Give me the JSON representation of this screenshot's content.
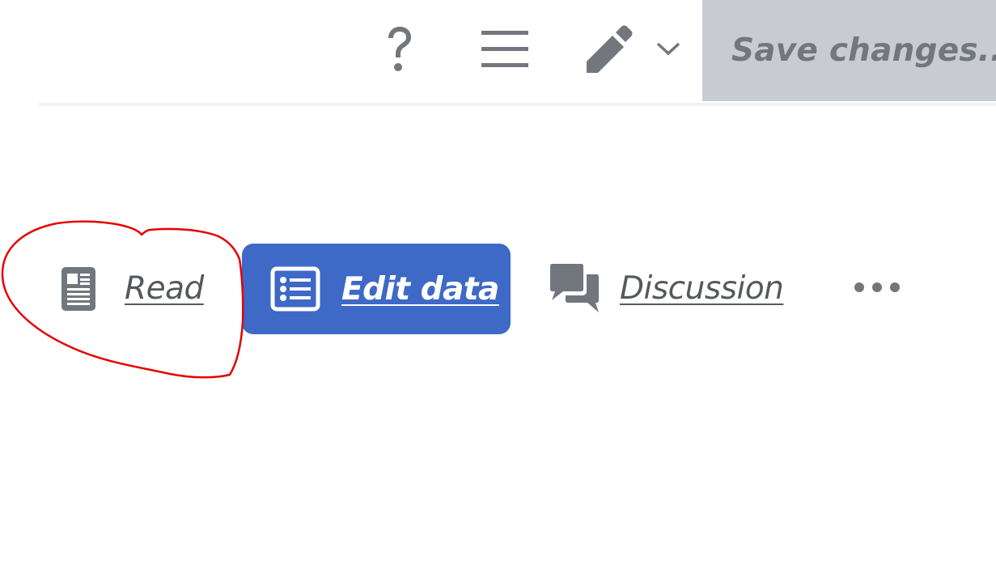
{
  "toolbar": {
    "help_icon": "help-icon",
    "menu_icon": "hamburger-menu-icon",
    "edit_icon": "pencil-icon",
    "dropdown_icon": "chevron-down-icon",
    "save_label": "Save changes..."
  },
  "tabs": [
    {
      "label": "Read",
      "icon": "document-icon",
      "selected": false
    },
    {
      "label": "Edit data",
      "icon": "list-icon",
      "selected": true
    },
    {
      "label": "Discussion",
      "icon": "speech-bubbles-icon",
      "selected": false
    }
  ],
  "more_icon": "ellipsis-icon",
  "colors": {
    "icon_gray": "#72777d",
    "tab_text": "#54595d",
    "selected_tab_bg": "#3e69c6",
    "save_button_bg": "#c8ccd1",
    "annotation_red": "#e60000"
  }
}
